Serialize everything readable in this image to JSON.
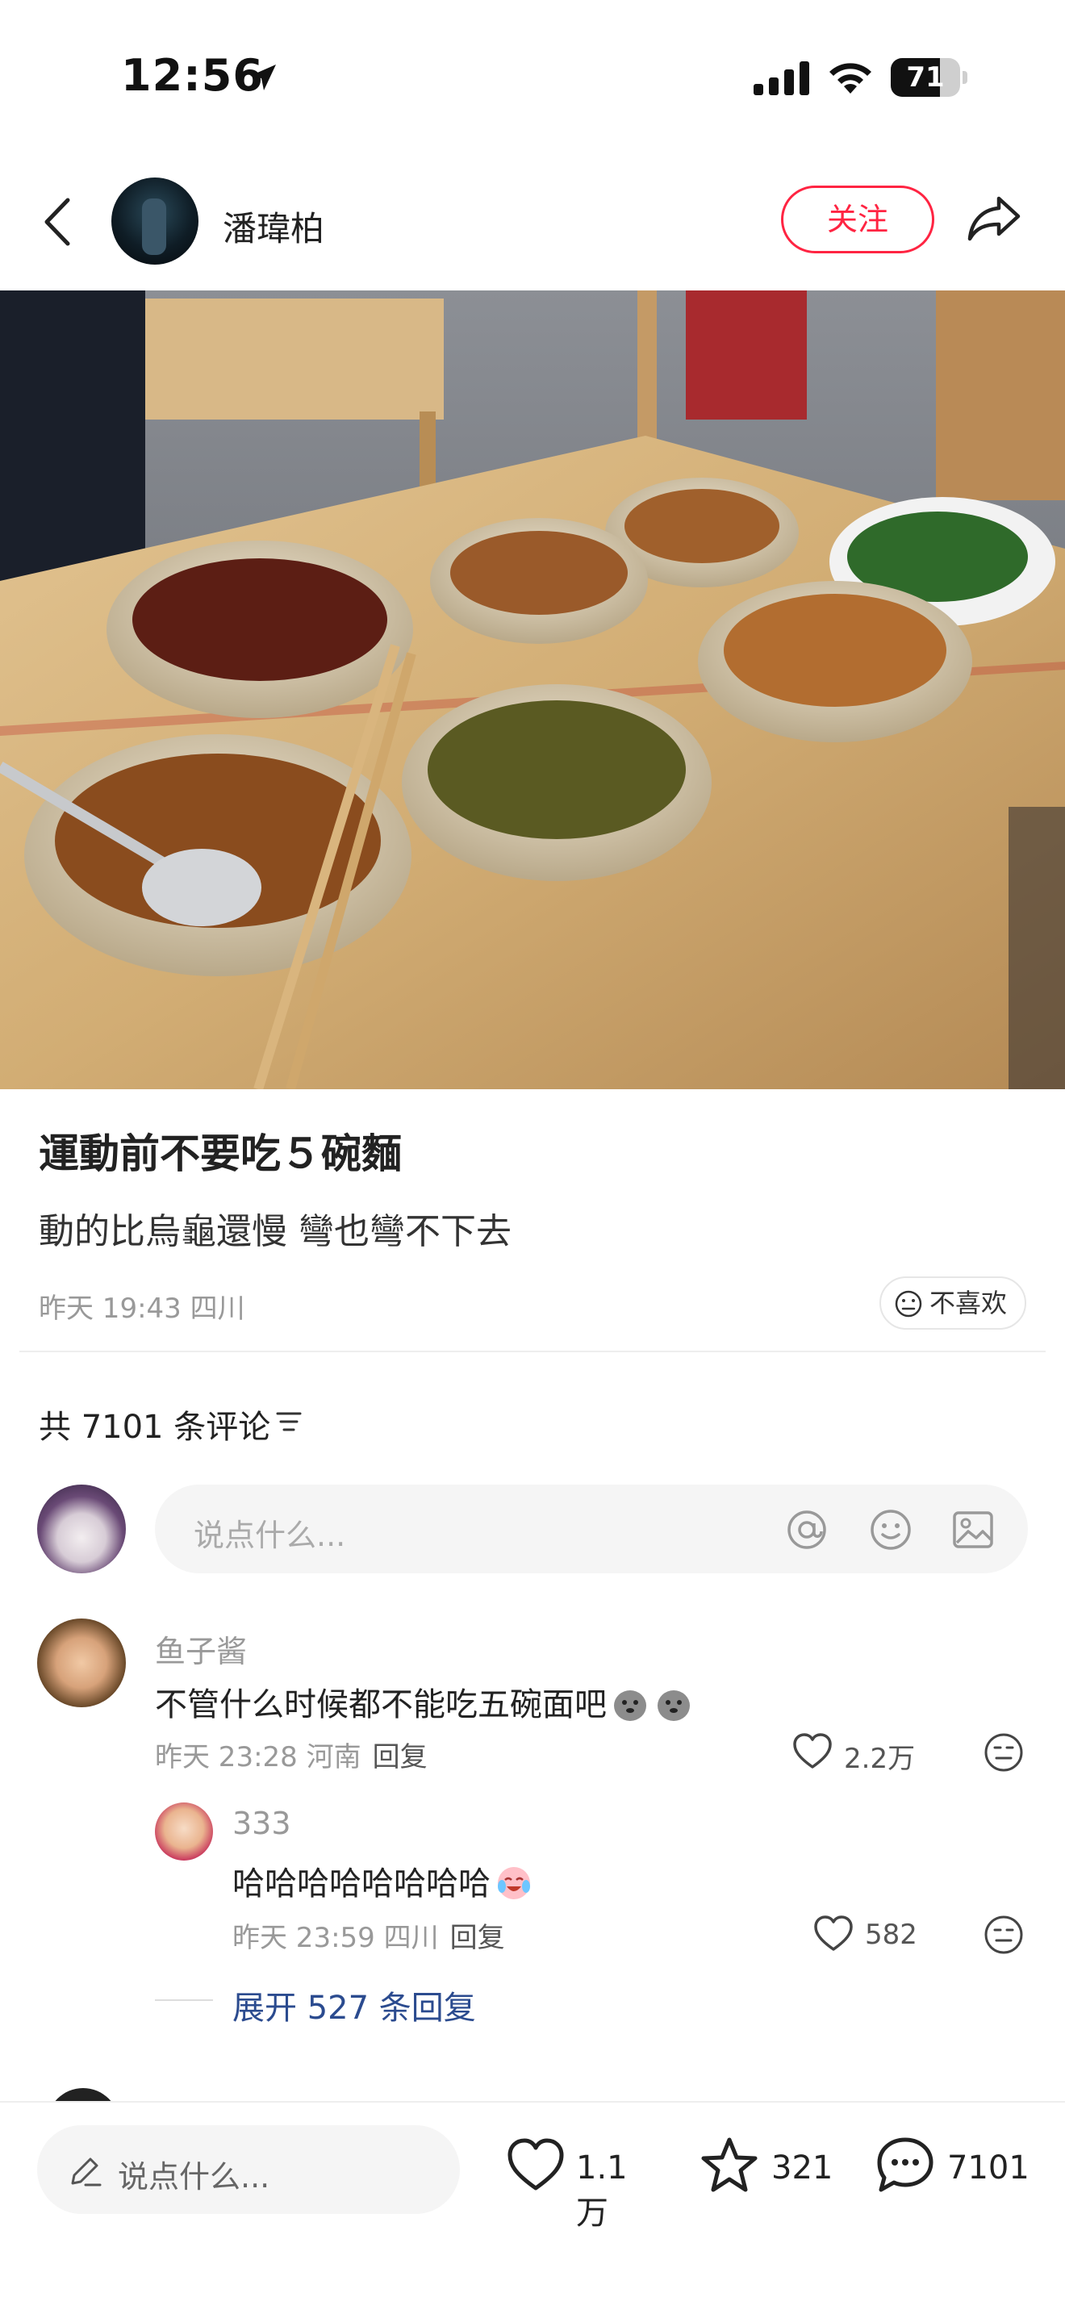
{
  "status_bar": {
    "time": "12:56",
    "battery": "71",
    "battery_level": 0.71
  },
  "header": {
    "author": "潘瑋柏",
    "follow_label": "关注"
  },
  "post": {
    "title": "運動前不要吃５碗麵",
    "body": "動的比烏龜還慢 彎也彎不下去",
    "meta": "昨天 19:43 四川",
    "dislike_label": "不喜欢"
  },
  "comments_section": {
    "count_label": "共 7101 条评论",
    "input_placeholder": "说点什么..."
  },
  "comments": [
    {
      "name": "鱼子酱",
      "text": "不管什么时候都不能吃五碗面吧",
      "meta": "昨天 23:28 河南",
      "reply_label": "回复",
      "likes": "2.2万"
    }
  ],
  "replies": [
    {
      "name": "333",
      "text": "哈哈哈哈哈哈哈哈",
      "meta": "昨天 23:59 四川",
      "reply_label": "回复",
      "likes": "582"
    }
  ],
  "expand_replies": "展开 527 条回复",
  "bottom_bar": {
    "input_placeholder": "说点什么...",
    "likes": "1.1万",
    "favorites": "321",
    "comments": "7101"
  },
  "colors": {
    "accent": "#ff2442",
    "link": "#2b4b8f"
  }
}
